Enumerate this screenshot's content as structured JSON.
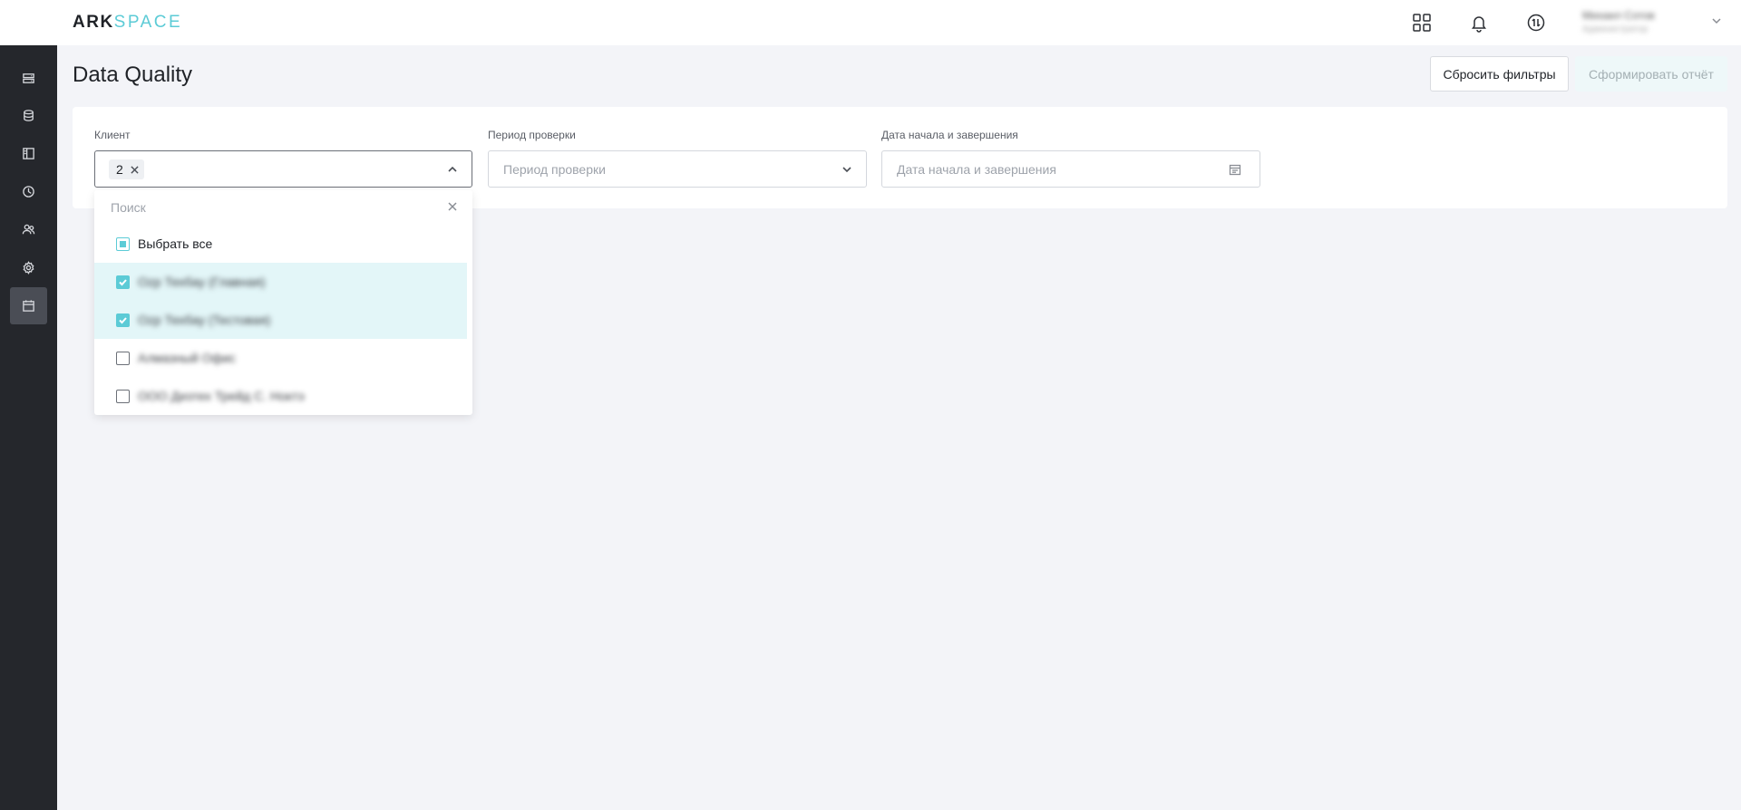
{
  "app": {
    "logo_part1": "ARK",
    "logo_part2": "SPACE",
    "accent_color": "#5ccbd6",
    "sidebar_color": "#25272c"
  },
  "sidebar": {
    "items": [
      {
        "name": "sidebar-item-servers",
        "icon": "server-list-icon"
      },
      {
        "name": "sidebar-item-database",
        "icon": "database-icon"
      },
      {
        "name": "sidebar-item-panels",
        "icon": "panel-layout-icon"
      },
      {
        "name": "sidebar-item-history",
        "icon": "clock-icon"
      },
      {
        "name": "sidebar-item-users",
        "icon": "users-icon"
      },
      {
        "name": "sidebar-item-settings",
        "icon": "gear-icon"
      },
      {
        "name": "sidebar-item-calendar",
        "icon": "calendar-icon",
        "active": true
      }
    ]
  },
  "header": {
    "icons": [
      "apps-grid-icon",
      "bell-icon",
      "sync-icon"
    ],
    "user": {
      "name": "Михаил Сотов",
      "role": "Администратор",
      "menu_icon": "chevron-down-icon"
    }
  },
  "page": {
    "title": "Data Quality",
    "reset_button": "Сбросить фильтры",
    "report_button": "Сформировать отчёт"
  },
  "filters": {
    "client": {
      "label": "Клиент",
      "selected_count": "2"
    },
    "period": {
      "label": "Период проверки",
      "placeholder": "Период проверки"
    },
    "date_range": {
      "label": "Дата начала и завершения",
      "placeholder": "Дата начала и завершения"
    }
  },
  "dropdown": {
    "search_placeholder": "Поиск",
    "select_all": "Выбрать все",
    "options": [
      {
        "label": "Ozp Техбау (Главная)",
        "checked": true
      },
      {
        "label": "Ozp Техбау (Тестовая)",
        "checked": true
      },
      {
        "label": "Алмазный Офис",
        "checked": false
      },
      {
        "label": "ООО Дизтех Трейд С. Ноктэ",
        "checked": false
      }
    ]
  }
}
